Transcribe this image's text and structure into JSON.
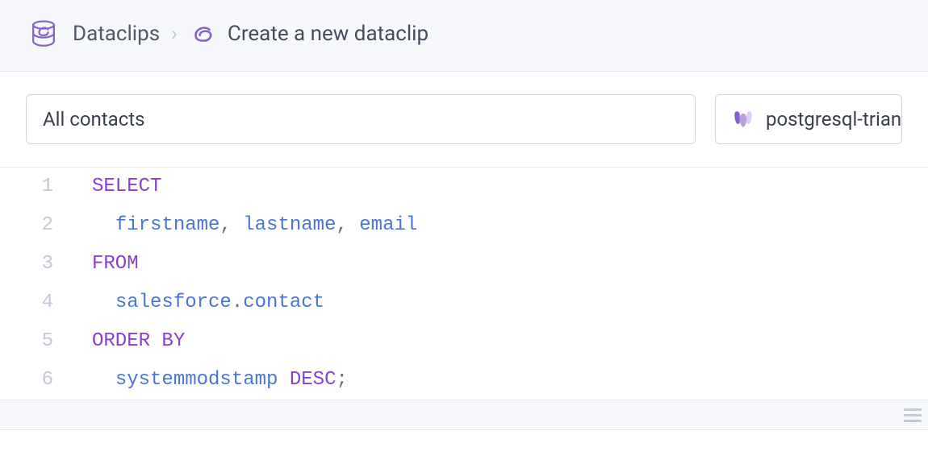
{
  "breadcrumb": {
    "root": "Dataclips",
    "current": "Create a new dataclip"
  },
  "form": {
    "name_value": "All contacts",
    "datastore_selected": "postgresql-triang"
  },
  "editor": {
    "lines": [
      {
        "n": "1",
        "tokens": [
          {
            "cls": "kw",
            "t": "SELECT"
          }
        ]
      },
      {
        "n": "2",
        "tokens": [
          {
            "cls": "pn",
            "t": "  "
          },
          {
            "cls": "id",
            "t": "firstname"
          },
          {
            "cls": "pn",
            "t": ", "
          },
          {
            "cls": "id",
            "t": "lastname"
          },
          {
            "cls": "pn",
            "t": ", "
          },
          {
            "cls": "id",
            "t": "email"
          }
        ]
      },
      {
        "n": "3",
        "tokens": [
          {
            "cls": "kw",
            "t": "FROM"
          }
        ]
      },
      {
        "n": "4",
        "tokens": [
          {
            "cls": "pn",
            "t": "  "
          },
          {
            "cls": "id",
            "t": "salesforce"
          },
          {
            "cls": "pn",
            "t": "."
          },
          {
            "cls": "id",
            "t": "contact"
          }
        ]
      },
      {
        "n": "5",
        "tokens": [
          {
            "cls": "kw",
            "t": "ORDER BY"
          }
        ]
      },
      {
        "n": "6",
        "tokens": [
          {
            "cls": "pn",
            "t": "  "
          },
          {
            "cls": "id",
            "t": "systemmodstamp"
          },
          {
            "cls": "pn",
            "t": " "
          },
          {
            "cls": "kw",
            "t": "DESC"
          },
          {
            "cls": "pn",
            "t": ";"
          }
        ]
      }
    ]
  }
}
